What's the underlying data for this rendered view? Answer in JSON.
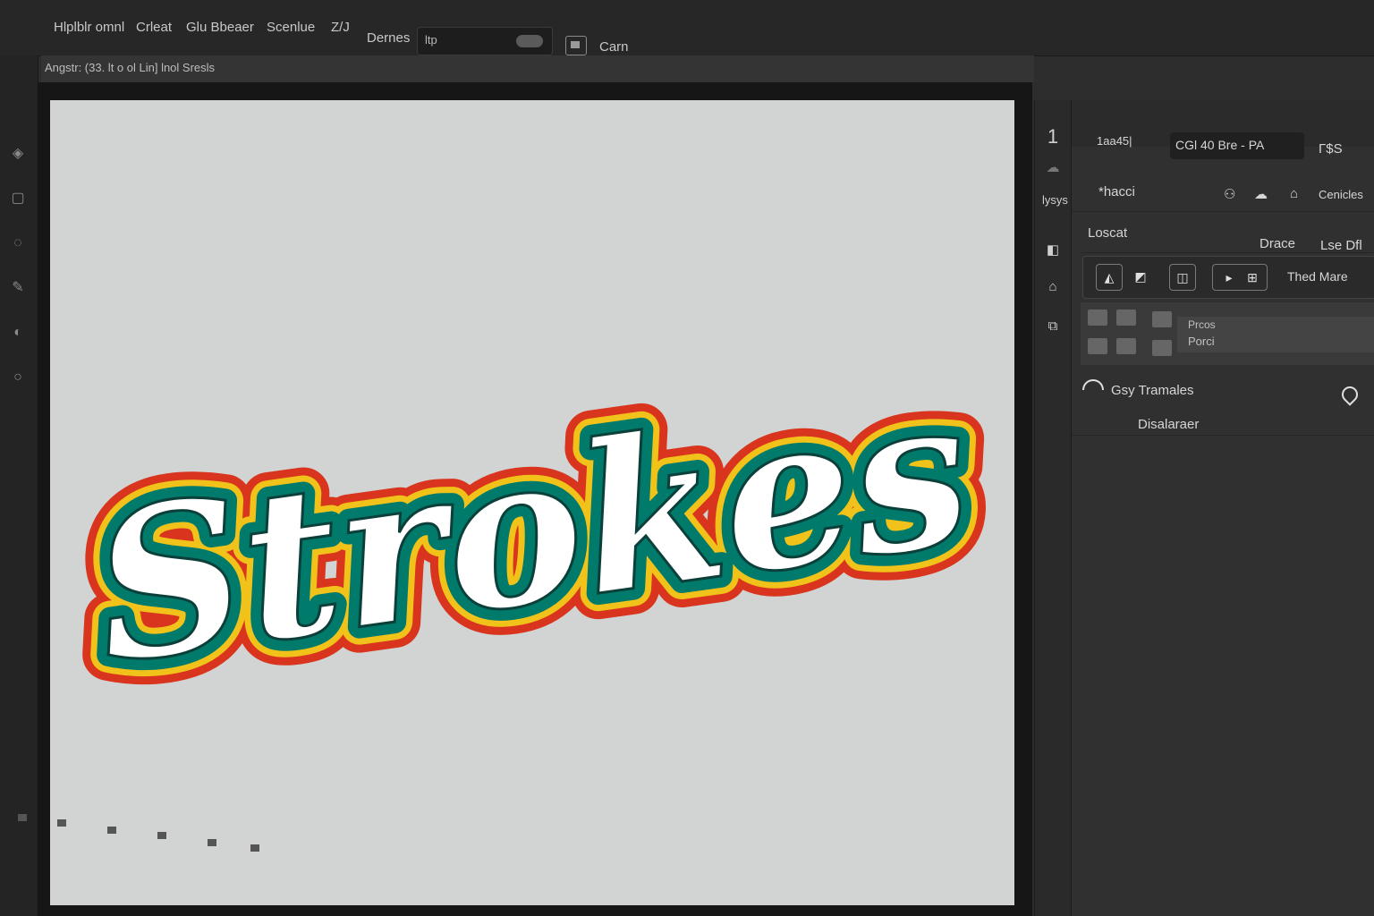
{
  "menu": {
    "items": [
      "Hlplblr omnl",
      "Crleat",
      "Glu Bbeaer",
      "Scenlue",
      "Z/J",
      "Dernes"
    ],
    "zoom_value": "ltp",
    "extra": "Carn"
  },
  "document": {
    "tab_label": "Angstr: (33. lt o ol Lin] lnol Sresls"
  },
  "canvas": {
    "word": "Strokes",
    "fill_color": "#ffffff",
    "inner_stroke_color": "#007a6b",
    "middle_stroke_color": "#f0c21a",
    "outer_stroke_color": "#d9341e",
    "background_color": "#d1d4d2"
  },
  "icon_column": {
    "items": [
      "1",
      "lysys"
    ]
  },
  "panel": {
    "header_title": "1aa45|",
    "mode_label": "CGl 40 Bre - PA",
    "mode_extra": "Γ$S",
    "properties_label": "*hacci",
    "properties_extra": "Cenicles",
    "layers_label": "Loscat",
    "layers_col1": "Drace",
    "layers_col2": "Lse Dfl",
    "layer_controls_label": "Thed Mare",
    "layer_fx_1": "Prcos",
    "layer_fx_2": "Porci",
    "layer_name": "Gsy Tramales",
    "layer_sub": "Disalaraer"
  }
}
